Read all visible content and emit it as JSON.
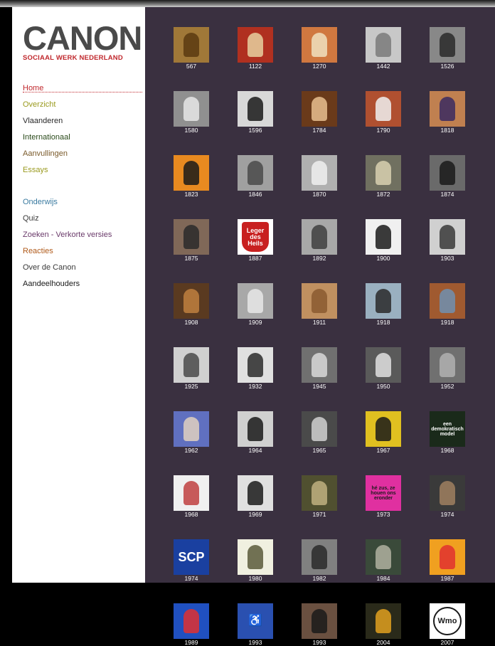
{
  "logo": {
    "word": "CANON",
    "subtitle": "SOCIAAL WERK NEDERLAND"
  },
  "nav_main": [
    {
      "label": "Home",
      "color": "#c0282d",
      "cls": "home"
    },
    {
      "label": "Overzicht",
      "color": "#9a9a1e"
    },
    {
      "label": "Vlaanderen",
      "color": "#2a2a2a"
    },
    {
      "label": "Internationaal",
      "color": "#2a4a1a"
    },
    {
      "label": "Aanvullingen",
      "color": "#7a5a2a"
    },
    {
      "label": "Essays",
      "color": "#9a9a1e"
    }
  ],
  "nav_secondary": [
    {
      "label": "Onderwijs",
      "color": "#3a7aa0"
    },
    {
      "label": "Quiz",
      "color": "#3a3a3a"
    },
    {
      "label": "Zoeken - Verkorte versies",
      "color": "#6a3a6a"
    },
    {
      "label": "Reacties",
      "color": "#b05a1a"
    },
    {
      "label": "Over de Canon",
      "color": "#3a3a3a"
    },
    {
      "label": "Aandeelhouders",
      "color": "#1a1a1a"
    }
  ],
  "tiles": [
    {
      "year": "567",
      "bg": "#a07838",
      "fg": "#5a3a10",
      "text": "",
      "tc": "#000"
    },
    {
      "year": "1122",
      "bg": "#b03020",
      "fg": "#e8d0a0",
      "text": "",
      "tc": "#000"
    },
    {
      "year": "1270",
      "bg": "#d07840",
      "fg": "#f0e0c0",
      "text": "",
      "tc": "#000"
    },
    {
      "year": "1442",
      "bg": "#c8c8c8",
      "fg": "#7a7a7a",
      "text": "",
      "tc": "#000"
    },
    {
      "year": "1526",
      "bg": "#888888",
      "fg": "#2a2a2a",
      "text": "",
      "tc": "#000"
    },
    {
      "year": "1580",
      "bg": "#909090",
      "fg": "#e8e8e8",
      "text": "",
      "tc": "#000"
    },
    {
      "year": "1596",
      "bg": "#d8d8d8",
      "fg": "#1a1a1a",
      "text": "",
      "tc": "#000"
    },
    {
      "year": "1784",
      "bg": "#6a3a1a",
      "fg": "#e8c090",
      "text": "",
      "tc": "#000"
    },
    {
      "year": "1790",
      "bg": "#b05030",
      "fg": "#f0f0f0",
      "text": "",
      "tc": "#000"
    },
    {
      "year": "1818",
      "bg": "#c08050",
      "fg": "#3a2a60",
      "text": "",
      "tc": "#000"
    },
    {
      "year": "1823",
      "bg": "#e88a20",
      "fg": "#1a1a1a",
      "text": "",
      "tc": "#000"
    },
    {
      "year": "1846",
      "bg": "#a0a0a0",
      "fg": "#4a4a4a",
      "text": "",
      "tc": "#000"
    },
    {
      "year": "1870",
      "bg": "#b0b0b0",
      "fg": "#f0f0f0",
      "text": "",
      "tc": "#000"
    },
    {
      "year": "1872",
      "bg": "#707060",
      "fg": "#d8d0b0",
      "text": "",
      "tc": "#000"
    },
    {
      "year": "1874",
      "bg": "#6a6a6a",
      "fg": "#1a1a1a",
      "text": "",
      "tc": "#000"
    },
    {
      "year": "1875",
      "bg": "#806858",
      "fg": "#2a2a2a",
      "text": "",
      "tc": "#000"
    },
    {
      "year": "1887",
      "bg": "#ffffff",
      "fg": "#c82020",
      "text": "Leger des Heils",
      "tc": "#ffffff"
    },
    {
      "year": "1892",
      "bg": "#a8a8a8",
      "fg": "#404040",
      "text": "",
      "tc": "#000"
    },
    {
      "year": "1900",
      "bg": "#f0f0f0",
      "fg": "#1a1a1a",
      "text": "",
      "tc": "#000"
    },
    {
      "year": "1903",
      "bg": "#d0d0d0",
      "fg": "#3a3a3a",
      "text": "",
      "tc": "#000"
    },
    {
      "year": "1908",
      "bg": "#5a3a20",
      "fg": "#c08040",
      "text": "",
      "tc": "#000"
    },
    {
      "year": "1909",
      "bg": "#a8a8a8",
      "fg": "#e8e8e8",
      "text": "",
      "tc": "#000"
    },
    {
      "year": "1911",
      "bg": "#c09060",
      "fg": "#8a5a30",
      "text": "",
      "tc": "#000"
    },
    {
      "year": "1918",
      "bg": "#9ab0c0",
      "fg": "#2a2a2a",
      "text": "",
      "tc": "#000"
    },
    {
      "year": "1918",
      "bg": "#a05a30",
      "fg": "#7090b0",
      "text": "",
      "tc": "#000"
    },
    {
      "year": "1925",
      "bg": "#d0d0d0",
      "fg": "#4a4a4a",
      "text": "",
      "tc": "#000"
    },
    {
      "year": "1932",
      "bg": "#e0e0e0",
      "fg": "#2a2a2a",
      "text": "",
      "tc": "#000"
    },
    {
      "year": "1945",
      "bg": "#707070",
      "fg": "#d8d8d8",
      "text": "",
      "tc": "#000"
    },
    {
      "year": "1950",
      "bg": "#5a5a5a",
      "fg": "#e0e0e0",
      "text": "",
      "tc": "#000"
    },
    {
      "year": "1952",
      "bg": "#707070",
      "fg": "#b0b0b0",
      "text": "",
      "tc": "#000"
    },
    {
      "year": "1962",
      "bg": "#6070c0",
      "fg": "#e0d0c0",
      "text": "",
      "tc": "#000"
    },
    {
      "year": "1964",
      "bg": "#d0d0d0",
      "fg": "#1a1a1a",
      "text": "",
      "tc": "#000"
    },
    {
      "year": "1965",
      "bg": "#4a4a4a",
      "fg": "#d0d0d0",
      "text": "",
      "tc": "#000"
    },
    {
      "year": "1967",
      "bg": "#e0c020",
      "fg": "#1a1a1a",
      "text": "",
      "tc": "#000"
    },
    {
      "year": "1968",
      "bg": "#1a2a1a",
      "fg": "#f0f0f0",
      "text": "een demokratisch model",
      "tc": "#ffffff"
    },
    {
      "year": "1968",
      "bg": "#f0f0f0",
      "fg": "#c04040",
      "text": "",
      "tc": "#000"
    },
    {
      "year": "1969",
      "bg": "#e0e0e0",
      "fg": "#1a1a1a",
      "text": "",
      "tc": "#000"
    },
    {
      "year": "1971",
      "bg": "#505030",
      "fg": "#c0b080",
      "text": "",
      "tc": "#000"
    },
    {
      "year": "1973",
      "bg": "#e030a0",
      "fg": "#1a1a1a",
      "text": "hé zus, ze houen ons eronder",
      "tc": "#1a1a1a"
    },
    {
      "year": "1974",
      "bg": "#3a3a3a",
      "fg": "#a08060",
      "text": "",
      "tc": "#000"
    },
    {
      "year": "1974",
      "bg": "#1a40a0",
      "fg": "#ffffff",
      "text": "SCP",
      "tc": "#ffffff"
    },
    {
      "year": "1980",
      "bg": "#f0f0e0",
      "fg": "#5a5a3a",
      "text": "",
      "tc": "#000"
    },
    {
      "year": "1982",
      "bg": "#808080",
      "fg": "#2a2a2a",
      "text": "",
      "tc": "#000"
    },
    {
      "year": "1984",
      "bg": "#3a4a3a",
      "fg": "#b0b0a0",
      "text": "",
      "tc": "#000"
    },
    {
      "year": "1987",
      "bg": "#f0a020",
      "fg": "#e03030",
      "text": "",
      "tc": "#000"
    },
    {
      "year": "1989",
      "bg": "#2050c0",
      "fg": "#e03030",
      "text": "",
      "tc": "#000"
    },
    {
      "year": "1993",
      "bg": "#2a50b0",
      "fg": "#ffffff",
      "text": "♿",
      "tc": "#ffffff"
    },
    {
      "year": "1993",
      "bg": "#6a5040",
      "fg": "#1a1a1a",
      "text": "",
      "tc": "#000"
    },
    {
      "year": "2004",
      "bg": "#2a2a1a",
      "fg": "#e0a020",
      "text": "",
      "tc": "#000"
    },
    {
      "year": "2007",
      "bg": "#ffffff",
      "fg": "#1a1a1a",
      "text": "Wmo",
      "tc": "#1a1a1a"
    }
  ]
}
